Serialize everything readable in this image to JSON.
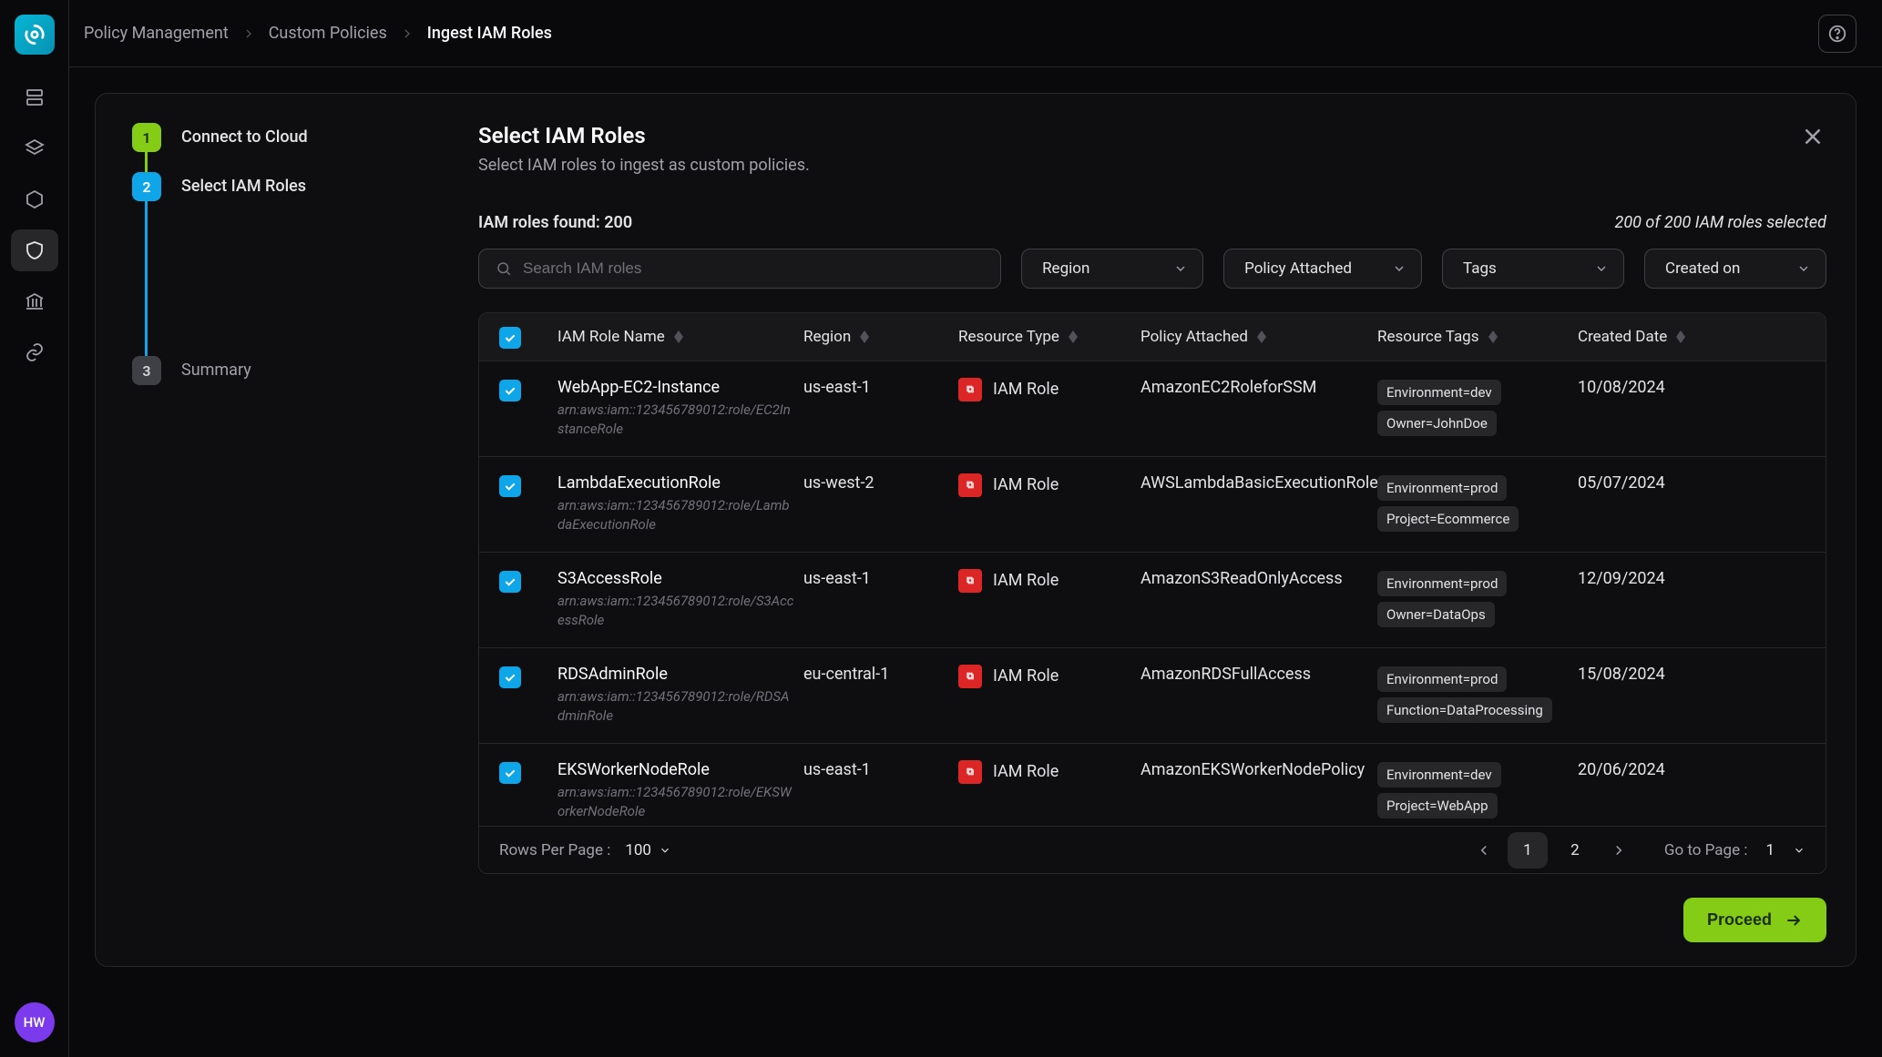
{
  "breadcrumbs": [
    "Policy Management",
    "Custom Policies",
    "Ingest IAM Roles"
  ],
  "avatar_initials": "HW",
  "stepper": [
    {
      "num": "1",
      "label": "Connect to Cloud",
      "state": "done"
    },
    {
      "num": "2",
      "label": "Select IAM Roles",
      "state": "active"
    },
    {
      "num": "3",
      "label": "Summary",
      "state": "pending"
    }
  ],
  "header": {
    "title": "Select IAM Roles",
    "subtitle": "Select IAM roles to ingest as custom policies.",
    "found_label": "IAM roles found: 200",
    "selected_label": "200 of 200 IAM roles selected"
  },
  "search": {
    "placeholder": "Search IAM roles"
  },
  "filters": [
    "Region",
    "Policy Attached",
    "Tags",
    "Created on"
  ],
  "columns": [
    "IAM Role Name",
    "Region",
    "Resource Type",
    "Policy Attached",
    "Resource Tags",
    "Created Date"
  ],
  "rows": [
    {
      "name": "WebApp-EC2-Instance",
      "arn": "arn:aws:iam::123456789012:role/EC2InstanceRole",
      "region": "us-east-1",
      "type": "IAM Role",
      "policy": "AmazonEC2RoleforSSM",
      "tags": [
        "Environment=dev",
        "Owner=JohnDoe"
      ],
      "created": "10/08/2024"
    },
    {
      "name": "LambdaExecutionRole",
      "arn": "arn:aws:iam::123456789012:role/LambdaExecutionRole",
      "region": "us-west-2",
      "type": "IAM Role",
      "policy": "AWSLambdaBasicExecutionRole",
      "tags": [
        "Environment=prod",
        "Project=Ecommerce"
      ],
      "created": "05/07/2024"
    },
    {
      "name": "S3AccessRole",
      "arn": "arn:aws:iam::123456789012:role/S3AccessRole",
      "region": "us-east-1",
      "type": "IAM Role",
      "policy": "AmazonS3ReadOnlyAccess",
      "tags": [
        "Environment=prod",
        "Owner=DataOps"
      ],
      "created": "12/09/2024"
    },
    {
      "name": "RDSAdminRole",
      "arn": "arn:aws:iam::123456789012:role/RDSAdminRole",
      "region": "eu-central-1",
      "type": "IAM Role",
      "policy": "AmazonRDSFullAccess",
      "tags": [
        "Environment=prod",
        "Function=DataProcessing"
      ],
      "created": "15/08/2024"
    },
    {
      "name": "EKSWorkerNodeRole",
      "arn": "arn:aws:iam::123456789012:role/EKSWorkerNodeRole",
      "region": "us-east-1",
      "type": "IAM Role",
      "policy": "AmazonEKSWorkerNodePolicy",
      "tags": [
        "Environment=dev",
        "Project=WebApp"
      ],
      "created": "20/06/2024"
    }
  ],
  "pager": {
    "rows_label": "Rows Per Page :",
    "rows_value": "100",
    "pages": [
      "1",
      "2"
    ],
    "go_label": "Go to Page :",
    "go_value": "1"
  },
  "proceed_label": "Proceed"
}
